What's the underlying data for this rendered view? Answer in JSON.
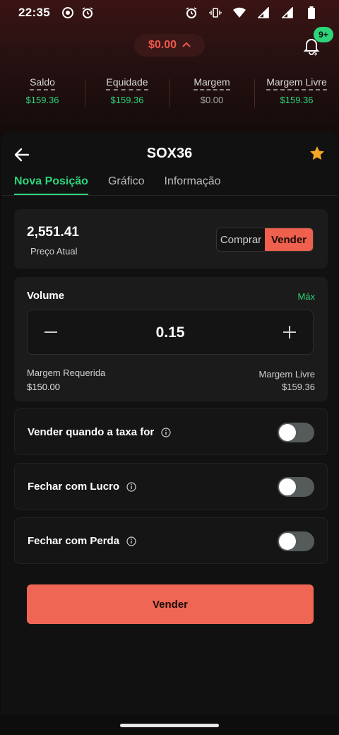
{
  "status_bar": {
    "time": "22:35",
    "left_icons": [
      "record-icon",
      "alarm-icon"
    ],
    "right_icons": [
      "alarm-icon",
      "vibrate-icon",
      "wifi-icon",
      "signal-icon",
      "signal-icon",
      "battery-icon"
    ]
  },
  "balance": {
    "value": "$0.00",
    "icon": "chevron-up-icon"
  },
  "notifications": {
    "badge": "9+",
    "icon": "bell-dollar-icon"
  },
  "stats": [
    {
      "label": "Saldo",
      "value": "$159.36",
      "tone": "positive"
    },
    {
      "label": "Equidade",
      "value": "$159.36",
      "tone": "positive"
    },
    {
      "label": "Margem",
      "value": "$0.00",
      "tone": "neutral"
    },
    {
      "label": "Margem Livre",
      "value": "$159.36",
      "tone": "positive"
    }
  ],
  "header": {
    "title": "SOX36",
    "back_icon": "arrow-left-icon",
    "favorite_icon": "star-icon"
  },
  "tabs": [
    {
      "label": "Nova Posição",
      "active": true
    },
    {
      "label": "Gráfico",
      "active": false
    },
    {
      "label": "Informação",
      "active": false
    }
  ],
  "price": {
    "value": "2,551.41",
    "label": "Preço Atual"
  },
  "side_toggle": {
    "buy": "Comprar",
    "sell": "Vender",
    "selected": "sell"
  },
  "volume": {
    "label": "Volume",
    "max_label": "Máx",
    "value": "0.15",
    "required_margin_label": "Margem Requerida",
    "required_margin_value": "$150.00",
    "free_margin_label": "Margem Livre",
    "free_margin_value": "$159.36"
  },
  "toggles": [
    {
      "label": "Vender quando a taxa for",
      "on": false
    },
    {
      "label": "Fechar com Lucro",
      "on": false
    },
    {
      "label": "Fechar com Perda",
      "on": false
    }
  ],
  "submit_label": "Vender",
  "colors": {
    "accent_green": "#2ed47a",
    "sell_red": "#f06654",
    "balance_red": "#f0584a"
  }
}
